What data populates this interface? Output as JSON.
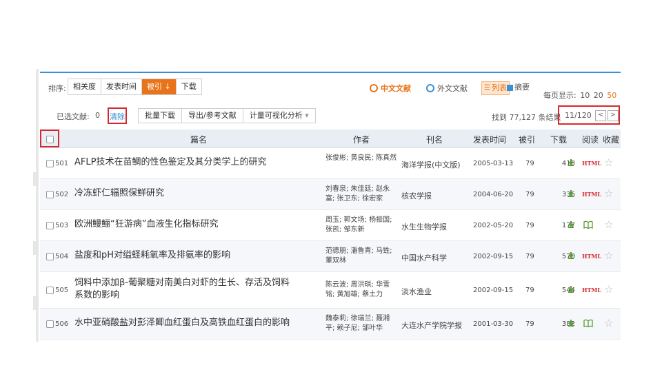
{
  "toolbar": {
    "sort_label": "排序:",
    "sort_options": [
      "相关度",
      "发表时间",
      "被引",
      "下载"
    ],
    "active_sort_suffix": "↓",
    "sources": {
      "chinese": "中文文献",
      "foreign": "外文文献"
    },
    "views": {
      "list": "列表",
      "abstract": "摘要"
    },
    "per_page_label": "每页显示:",
    "per_page_options": [
      "10",
      "20",
      "50"
    ],
    "per_page_selected": "50"
  },
  "selection": {
    "label": "已选文献:",
    "count": "0",
    "clear": "清除",
    "actions": [
      "批量下载",
      "导出/参考文献",
      "计量可视化分析"
    ],
    "dropdown_caret": "▾",
    "found_text": "找到 77,127 条结果",
    "pager_text": "11/120",
    "prev": "<",
    "next": ">"
  },
  "table": {
    "headers": {
      "title": "篇名",
      "author": "作者",
      "source": "刊名",
      "date": "发表时间",
      "cite": "被引",
      "download": "下载",
      "read": "阅读",
      "fav": "收藏"
    },
    "rows": [
      {
        "num": "501",
        "title": "AFLP技术在苗鲷的性色鉴定及其分类学上的研究",
        "author": "张俊彬; 黄良民; 陈真然",
        "source": "海洋学报(中文版)",
        "date": "2005-03-13",
        "cite": "79",
        "download": "418",
        "read": "HTML"
      },
      {
        "num": "502",
        "title": "冷冻虾仁辐照保鲜研究",
        "author": "刘春泉; 朱佳廷; 赵永富; 张卫东; 徐宏家",
        "source": "核农学报",
        "date": "2004-06-20",
        "cite": "79",
        "download": "336",
        "read": "HTML"
      },
      {
        "num": "503",
        "title": "欧洲鳗鲡“狂游病”血液生化指标研究",
        "author": "周玉; 郭文场; 杨振国; 张凯; 邹东新",
        "source": "水生生物学报",
        "date": "2002-05-20",
        "cite": "79",
        "download": "177",
        "read": "book"
      },
      {
        "num": "504",
        "title": "盐度和pH对缢蛏耗氧率及排氨率的影响",
        "author": "范德朋; 潘鲁青; 马甡; 董双林",
        "source": "中国水产科学",
        "date": "2002-09-15",
        "cite": "79",
        "download": "570",
        "read": "HTML"
      },
      {
        "num": "505",
        "title": "饲料中添加β-葡聚糖对南美白对虾的生长、存活及饲料系数的影响",
        "author": "陈云波; 周洪琪; 华雪铭; 黄旭雄; 蔡土力",
        "source": "淡水渔业",
        "date": "2002-09-15",
        "cite": "79",
        "download": "544",
        "read": "HTML"
      },
      {
        "num": "506",
        "title": "水中亚硝酸盐对彭泽鲫血红蛋白及高铁血红蛋白的影响",
        "author": "魏泰莉; 徐瑞兰; 聂湘平; 赖子尼; 邹叶华",
        "source": "大连水产学院学报",
        "date": "2001-03-30",
        "cite": "79",
        "download": "382",
        "read": "book"
      }
    ]
  },
  "colors": {
    "accent": "#e8731a",
    "link": "#3b8fd6",
    "highlight": "#d6282e",
    "header_bg": "#e9eef5"
  }
}
